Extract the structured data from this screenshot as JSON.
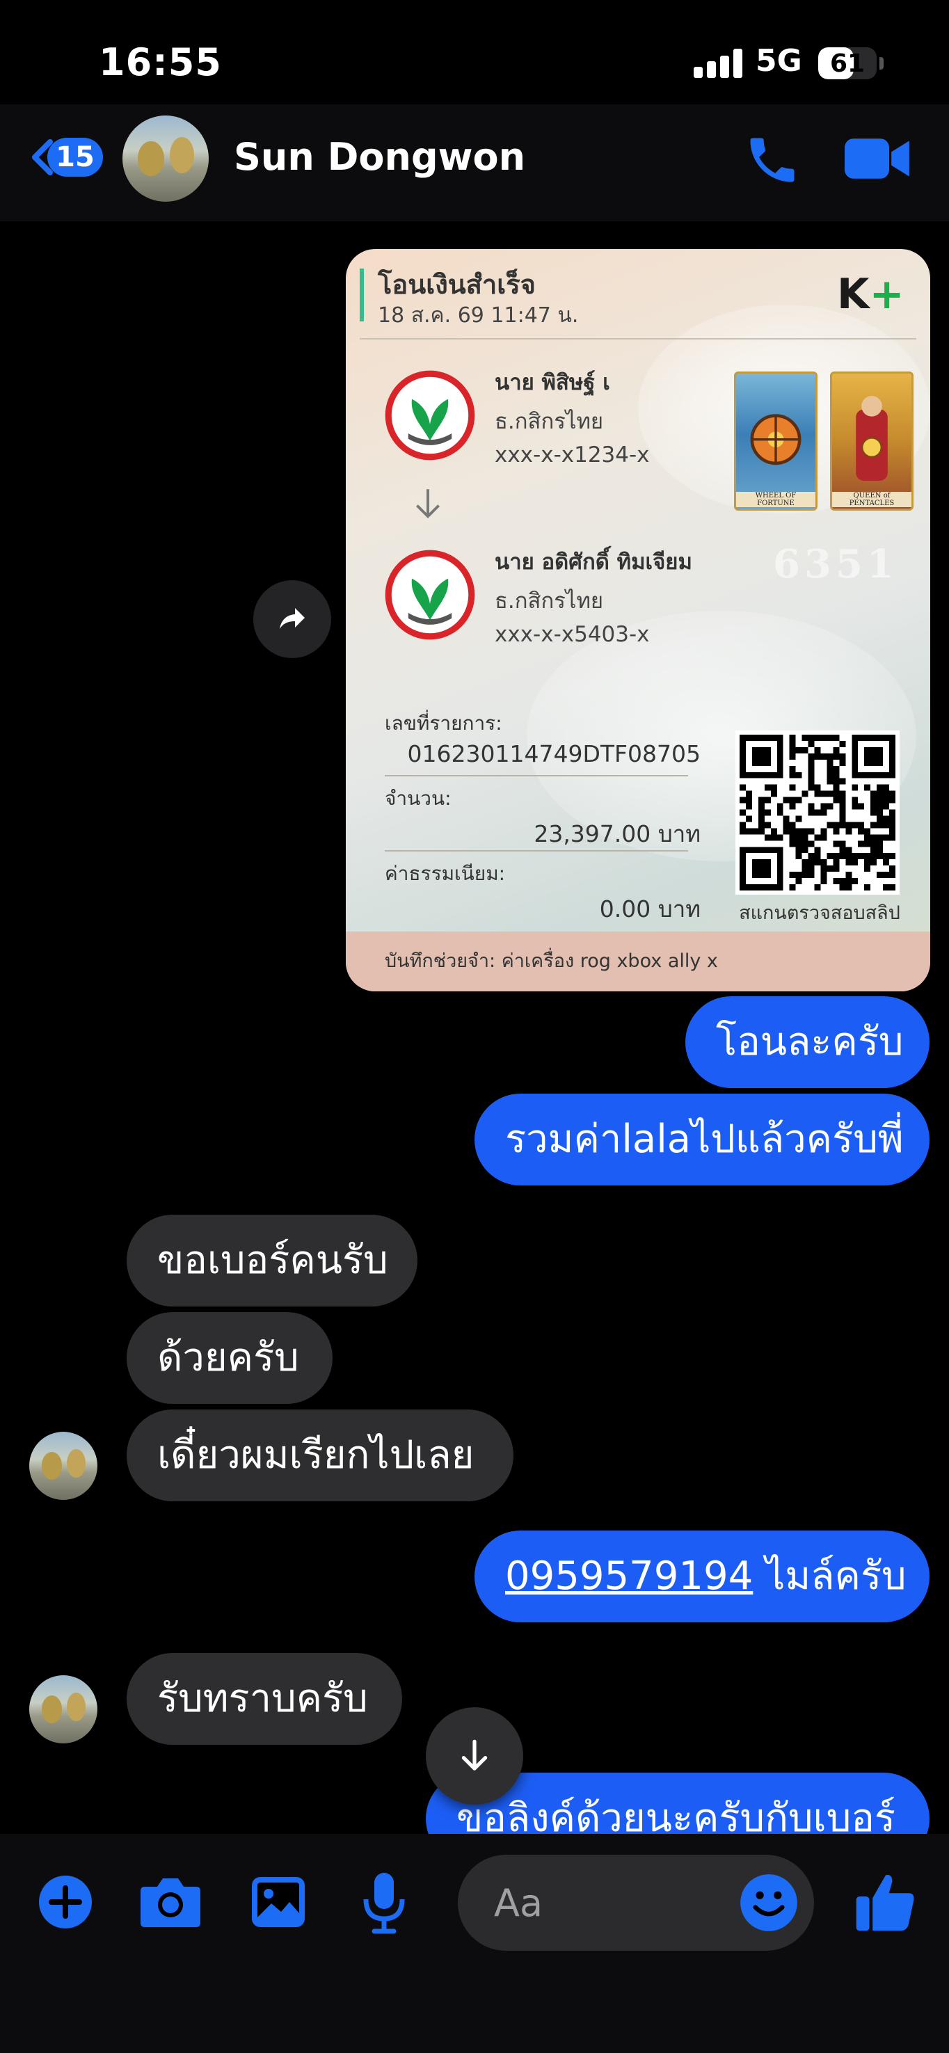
{
  "status_bar": {
    "time": "16:55",
    "network": "5G",
    "battery": "61",
    "battery_level": 0.61
  },
  "header": {
    "back_count": "15",
    "contact_name": "Sun Dongwon"
  },
  "slip": {
    "title": "โอนเงินสำเร็จ",
    "date": "18 ส.ค. 69  11:47 น.",
    "logo_k": "K",
    "logo_plus": "+",
    "sender": {
      "name": "นาย พิสิษฐ์ เ",
      "bank": "ธ.กสิกรไทย",
      "account": "xxx-x-x1234-x"
    },
    "receiver": {
      "name": "นาย อดิศักดิ์ ทิมเจียม",
      "bank": "ธ.กสิกรไทย",
      "account": "xxx-x-x5403-x"
    },
    "tarot_cards": [
      "WHEEL OF FORTUNE",
      "QUEEN of PENTACLES"
    ],
    "lucky_number": "6351",
    "ref_label": "เลขที่รายการ:",
    "ref_value": "016230114749DTF08705",
    "amount_label": "จำนวน:",
    "amount_value": "23,397.00 บาท",
    "fee_label": "ค่าธรรมเนียม:",
    "fee_value": "0.00 บาท",
    "qr_caption": "สแกนตรวจสอบสลิป",
    "note": "บันทึกช่วยจำ: ค่าเครื่อง rog xbox ally x"
  },
  "messages": {
    "m1": "โอนละครับ",
    "m2": "รวมค่าlalaไปแล้วครับพี่",
    "m3": "ขอเบอร์คนรับ",
    "m4": "ด้วยครับ",
    "m5": "เดี๋ยวผมเรียกไปเลย",
    "m6_phone": "0959579194",
    "m6_text": " ไมล์ครับ",
    "m7": "รับทราบครับ",
    "m8": "ขอลิงค์ด้วยนะครับกับเบอร์"
  },
  "composer": {
    "placeholder": "Aa"
  },
  "colors": {
    "accent": "#1d6cf6",
    "outgoing_bubble": "#1c5ef5",
    "incoming_bubble": "#2e2e30",
    "background": "#000000"
  },
  "icons": [
    "signal-icon",
    "battery-icon",
    "back-chevron-icon",
    "phone-icon",
    "video-icon",
    "share-icon",
    "arrow-down-icon",
    "plus-icon",
    "camera-icon",
    "image-icon",
    "mic-icon",
    "emoji-icon",
    "thumbs-up-icon"
  ]
}
